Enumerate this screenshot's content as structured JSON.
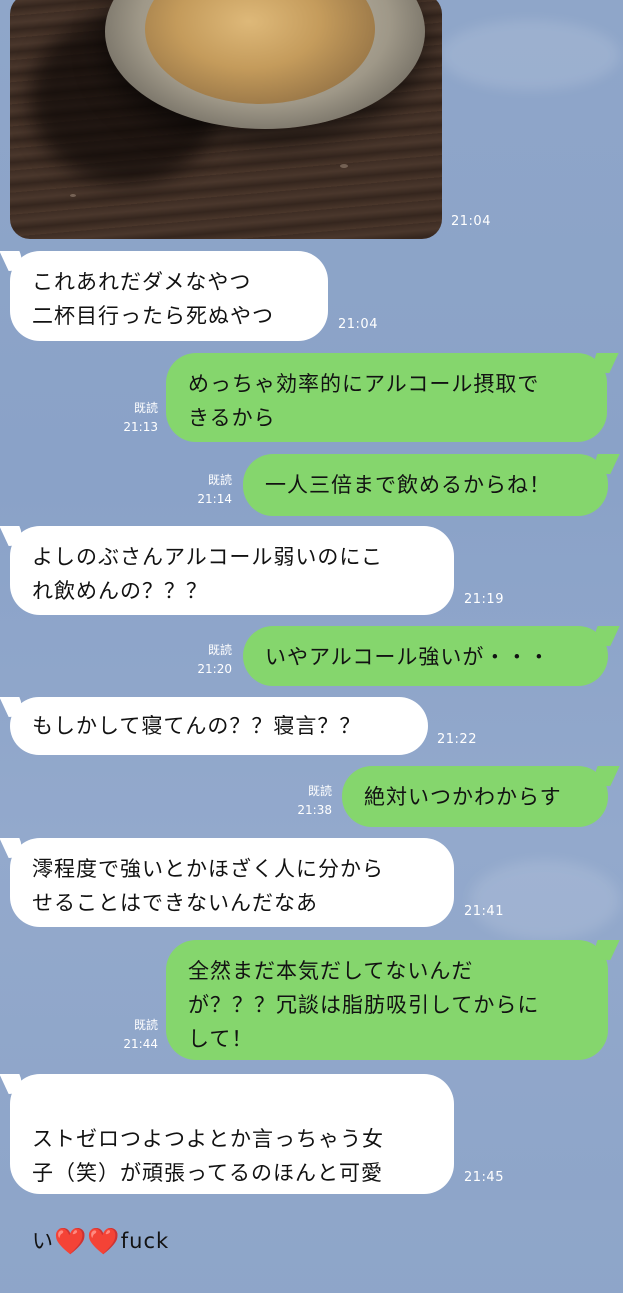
{
  "chat": {
    "photo_time": "21:04",
    "read_label": "既読",
    "messages": [
      {
        "side": "in",
        "text": "これあれだダメなやつ\n二杯目行ったら死ぬやつ",
        "time": "21:04"
      },
      {
        "side": "out",
        "text": "めっちゃ効率的にアルコール摂取で\nきるから",
        "time": "21:13",
        "read": true
      },
      {
        "side": "out",
        "text": "一人三倍まで飲めるからね！",
        "time": "21:14",
        "read": true
      },
      {
        "side": "in",
        "text": "よしのぶさんアルコール弱いのにこ\nれ飲めんの？？？",
        "time": "21:19"
      },
      {
        "side": "out",
        "text": "いやアルコール強いが・・・",
        "time": "21:20",
        "read": true
      },
      {
        "side": "in",
        "text": "もしかして寝てんの？？寝言？？",
        "time": "21:22"
      },
      {
        "side": "out",
        "text": "絶対いつかわからす",
        "time": "21:38",
        "read": true
      },
      {
        "side": "in",
        "text": "澪程度で強いとかほざく人に分から\nせることはできないんだなあ",
        "time": "21:41"
      },
      {
        "side": "out",
        "text": "全然まだ本気だしてないんだ\nが？？？冗談は脂肪吸引してからに\nして！",
        "time": "21:44",
        "read": true
      },
      {
        "side": "in",
        "text": "ストゼロつよつよとか言っちゃう女\n子（笑）が頑張ってるのほんと可愛",
        "line3_text": "fuck",
        "hearts": "❤️❤️",
        "time": "21:45"
      }
    ]
  }
}
